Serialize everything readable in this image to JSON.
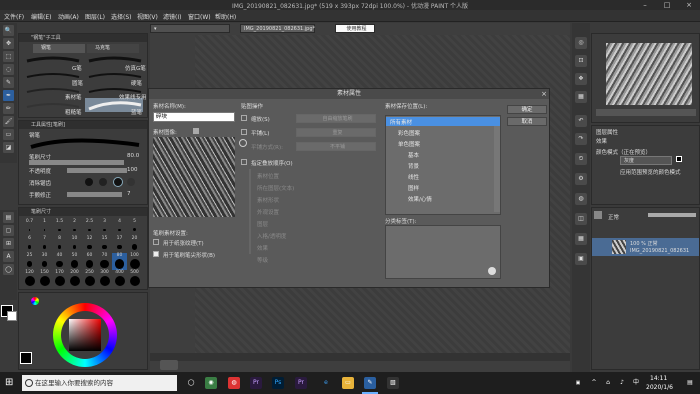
{
  "window": {
    "title": "IMG_20190821_082631.jpg* (519 x 393px 72dpi 100.0%) - 优动漫 PAINT 个人版"
  },
  "menu": [
    "文件(F)",
    "编辑(E)",
    "动画(A)",
    "图层(L)",
    "选择(S)",
    "视图(V)",
    "滤镜(I)",
    "窗口(W)",
    "帮助(H)"
  ],
  "tabs": {
    "doc1": "IMG_20190821_082631.jpg*",
    "doc2": "使用教程"
  },
  "brush_panel": {
    "title": "\"钢笔\"子工具",
    "tabs": [
      "钢笔",
      "马克笔"
    ],
    "brushes_left": [
      "G笔",
      "圆笔",
      "素材笔",
      "粗糙笔"
    ],
    "brushes_right": [
      "仿真G笔",
      "硬笔",
      "效果线专用",
      "蓝笔"
    ]
  },
  "tool_props": {
    "title": "工具属性[笔刷]",
    "sub": "钢笔",
    "rows": [
      {
        "label": "笔刷尺寸",
        "value": "80.0"
      },
      {
        "label": "不透明度",
        "value": "100"
      },
      {
        "label": "消除锯齿",
        "value": ""
      },
      {
        "label": "手颤修正",
        "value": "7"
      }
    ]
  },
  "brush_size_panel": {
    "title": "笔刷尺寸",
    "sizes": [
      "0.7",
      "1",
      "1.5",
      "2",
      "2.5",
      "3",
      "4",
      "5",
      "6",
      "7",
      "8",
      "10",
      "12",
      "15",
      "17",
      "20",
      "25",
      "30",
      "40",
      "50",
      "60",
      "70",
      "80",
      "100",
      "120",
      "150",
      "170",
      "200",
      "250",
      "300",
      "400",
      "500"
    ]
  },
  "dialog": {
    "title": "素材属性",
    "material_name_label": "素材名称(M):",
    "material_name_value": "碎块",
    "material_image_label": "素材图像:",
    "brush_tip_label": "笔刷素材设置:",
    "opt_texture": "用于纸张纹理(T)",
    "opt_brush_tip": "用于笔刷笔尖形状(B)",
    "tiling_head": "贴图操作",
    "tile_scale": "缩放(S)",
    "tile_scale_value": "自由缩放笔刷",
    "tile_repeat": "平铺(L)",
    "tile_repeat_value": "重复",
    "tile_shape_label": "平铺方式(R):",
    "tile_shape_value": "不平铺",
    "layer_order": "指定叠放顺序(O)",
    "group_items": [
      "素材位置",
      "所在图层(文本)",
      "素材形状",
      "外观设置",
      "图层",
      "入格/透明度",
      "效果",
      "等级"
    ],
    "save_loc_label": "素材保存位置(L):",
    "ok": "确定",
    "cancel": "取消",
    "search_tag_label": "分类标签(T):",
    "tree": [
      "所有素材",
      "彩色图案",
      "单色图案",
      "基本",
      "背景",
      "线性",
      "图样",
      "效果/心情"
    ]
  },
  "right_panels": {
    "layer_props_title": "图层属性",
    "effect": "效果",
    "blend_label": "颜色模式（正在预览）",
    "blend_value": "灰度",
    "sublabel": "应用范围预览的颜色模式",
    "layer_blend_mode": "正常",
    "layer_name_1": "100 % 正常",
    "layer_name_2": "IMG_20190821_082631"
  },
  "taskbar": {
    "search_placeholder": "在这里输入你要搜索的内容",
    "time": "14:11",
    "date": "2020/1/6",
    "lang": "中"
  },
  "colors": {
    "accent": "#3c7fd4",
    "dialog_bg": "#5a5a5a",
    "tree_selected": "#4a90e2"
  }
}
